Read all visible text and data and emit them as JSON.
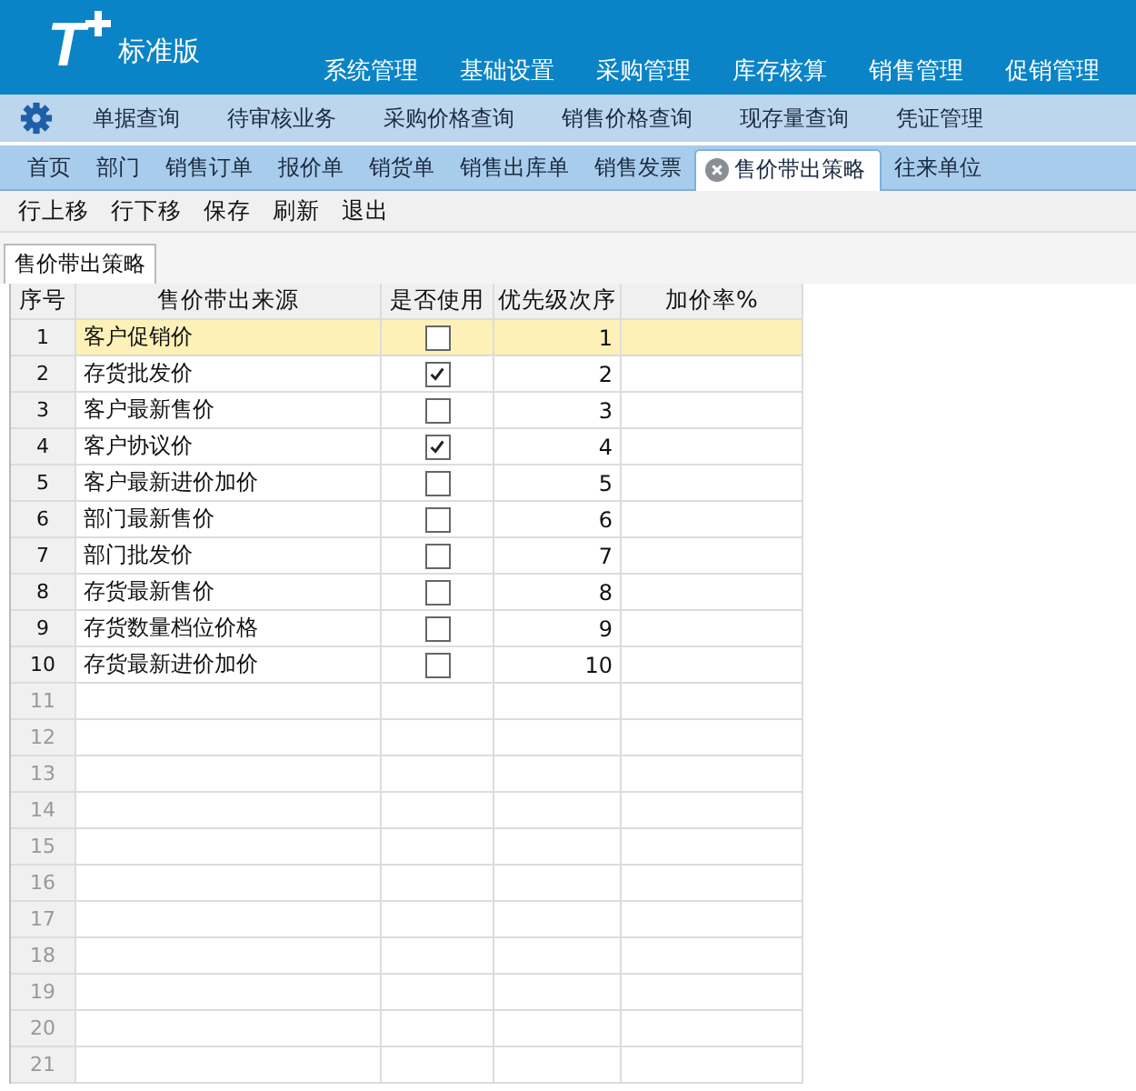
{
  "header": {
    "logo": "T",
    "edition": "标准版",
    "menu": [
      "系统管理",
      "基础设置",
      "采购管理",
      "库存核算",
      "销售管理",
      "促销管理"
    ]
  },
  "quick_bar": [
    "单据查询",
    "待审核业务",
    "采购价格查询",
    "销售价格查询",
    "现存量查询",
    "凭证管理"
  ],
  "tabs": [
    {
      "label": "首页",
      "selected": false
    },
    {
      "label": "部门",
      "selected": false
    },
    {
      "label": "销售订单",
      "selected": false
    },
    {
      "label": "报价单",
      "selected": false
    },
    {
      "label": "销货单",
      "selected": false
    },
    {
      "label": "销售出库单",
      "selected": false
    },
    {
      "label": "销售发票",
      "selected": false
    },
    {
      "label": "售价带出策略",
      "selected": true
    },
    {
      "label": "往来单位",
      "selected": false
    }
  ],
  "toolbar": [
    "行上移",
    "行下移",
    "保存",
    "刷新",
    "退出"
  ],
  "sub_tab": "售价带出策略",
  "table": {
    "columns": [
      "序号",
      "售价带出来源",
      "是否使用",
      "优先级次序",
      "加价率%"
    ],
    "rows": [
      {
        "no": "1",
        "source": "客户促销价",
        "used": false,
        "priority": "1",
        "selected": true
      },
      {
        "no": "2",
        "source": "存货批发价",
        "used": true,
        "priority": "2",
        "selected": false
      },
      {
        "no": "3",
        "source": "客户最新售价",
        "used": false,
        "priority": "3",
        "selected": false
      },
      {
        "no": "4",
        "source": "客户协议价",
        "used": true,
        "priority": "4",
        "selected": false
      },
      {
        "no": "5",
        "source": "客户最新进价加价",
        "used": false,
        "priority": "5",
        "selected": false
      },
      {
        "no": "6",
        "source": "部门最新售价",
        "used": false,
        "priority": "6",
        "selected": false
      },
      {
        "no": "7",
        "source": "部门批发价",
        "used": false,
        "priority": "7",
        "selected": false
      },
      {
        "no": "8",
        "source": "存货最新售价",
        "used": false,
        "priority": "8",
        "selected": false
      },
      {
        "no": "9",
        "source": "存货数量档位价格",
        "used": false,
        "priority": "9",
        "selected": false
      },
      {
        "no": "10",
        "source": "存货最新进价加价",
        "used": false,
        "priority": "10",
        "selected": false
      }
    ],
    "empty_rows": [
      "11",
      "12",
      "13",
      "14",
      "15",
      "16",
      "17",
      "18",
      "19",
      "20",
      "21"
    ]
  }
}
